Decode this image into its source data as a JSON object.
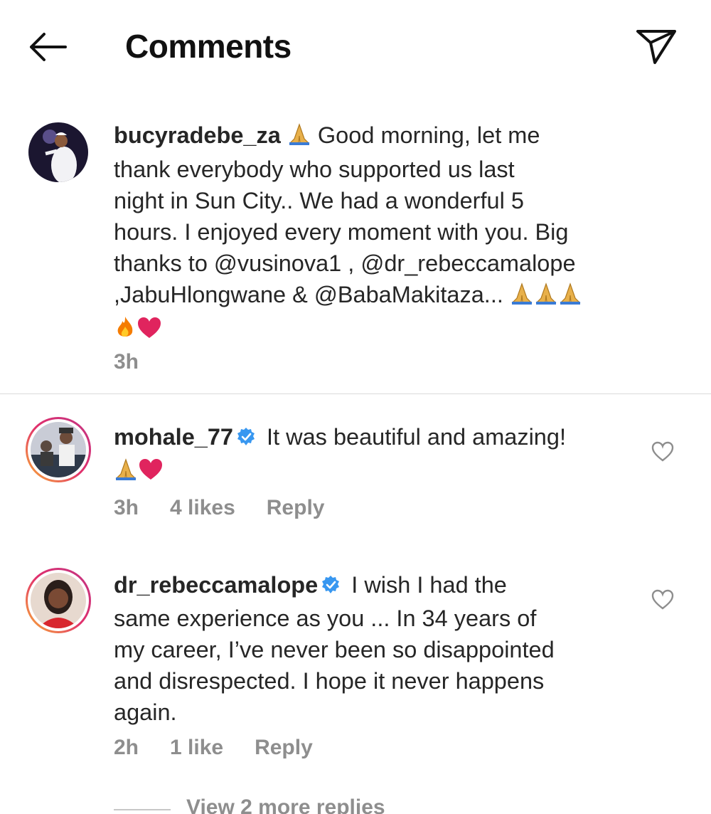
{
  "header": {
    "title": "Comments",
    "back_icon": "arrow-left-icon",
    "share_icon": "paper-plane-icon"
  },
  "caption": {
    "username": "bucyradebe_za",
    "text_1": "Good morning, let me",
    "line_2": "thank everybody who supported us last",
    "line_3": "night in Sun City.. We had a wonderful 5",
    "line_4": "hours. I enjoyed every moment with you. Big",
    "line_5": "thanks to @vusinova1 , @dr_rebeccamalope",
    "line_6": ",JabuHlongwane & @BabaMakitaza...",
    "time": "3h"
  },
  "comments": [
    {
      "username": "mohale_77",
      "text_1": "It was beautiful and amazing!",
      "time": "3h",
      "likes": "4 likes",
      "reply": "Reply"
    },
    {
      "username": "dr_rebeccamalope",
      "text_1": "I wish I had the",
      "line_2": "same experience as you ... In 34 years of",
      "line_3": "my career,  I’ve never been so disappointed",
      "line_4": "and disrespected. I hope it never happens",
      "line_5": "again.",
      "time": "2h",
      "likes": "1 like",
      "reply": "Reply"
    }
  ],
  "view_more": "View 2 more replies",
  "colors": {
    "text": "#262626",
    "meta": "#8e8e8e",
    "verified": "#3897f0",
    "heart": "#e0245e"
  }
}
